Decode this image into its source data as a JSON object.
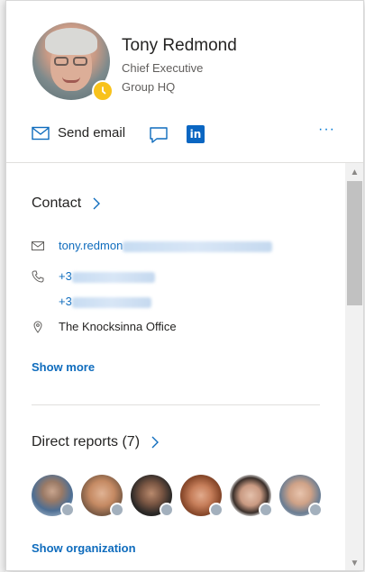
{
  "person": {
    "name": "Tony Redmond",
    "title": "Chief Executive",
    "department": "Group HQ",
    "status_color": "#f8c21c"
  },
  "actions": {
    "email_label": "Send email",
    "more_label": "···",
    "linkedin_label": "in"
  },
  "contact": {
    "title": "Contact",
    "email": "tony.redmon",
    "phone1": "+3",
    "phone2": "+3",
    "office": "The Knocksinna Office",
    "show_more": "Show more"
  },
  "reports": {
    "title": "Direct reports (7)",
    "show_org": "Show organization",
    "avatars": [
      "report-1",
      "report-2",
      "report-3",
      "report-4",
      "report-5",
      "report-6"
    ]
  },
  "colors": {
    "accent": "#0f6cbd",
    "linkedin": "#0a66c2",
    "presence_offline": "#a3b0bd"
  }
}
